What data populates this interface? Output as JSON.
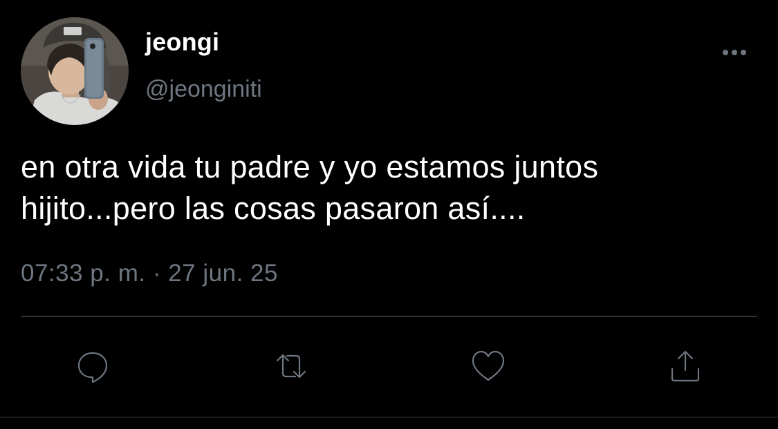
{
  "tweet": {
    "author": {
      "display_name": "jeongi",
      "handle": "@jeonginiti",
      "avatar_icon": "profile-photo"
    },
    "more_icon": "more-dots-icon",
    "text_lines": [
      "en otra vida tu padre y yo estamos juntos",
      "hijito...pero las cosas pasaron así...."
    ],
    "timestamp": "07:33 p. m. · 27 jun. 25",
    "actions": {
      "reply_icon": "reply-icon",
      "retweet_icon": "retweet-icon",
      "like_icon": "heart-icon",
      "share_icon": "share-icon"
    }
  },
  "colors": {
    "background": "#000000",
    "text_primary": "#ffffff",
    "text_secondary": "#6e7781",
    "divider": "#2f3336"
  }
}
